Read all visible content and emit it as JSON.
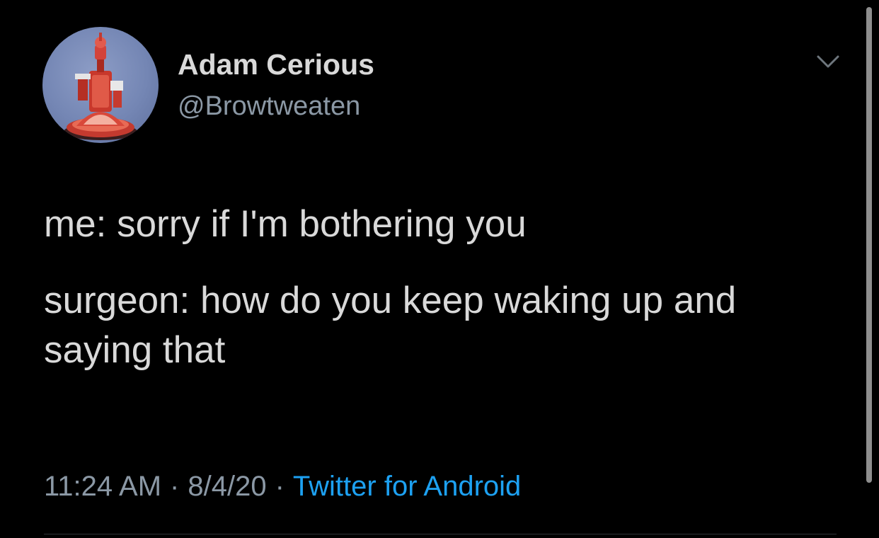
{
  "author": {
    "display_name": "Adam Cerious",
    "handle": "@Browtweaten",
    "avatar_icon": "robot-avatar"
  },
  "tweet": {
    "lines": [
      "me: sorry if I'm bothering you",
      "surgeon: how do you keep waking up and saying that"
    ]
  },
  "meta": {
    "time": "11:24 AM",
    "separator": "·",
    "date": "8/4/20",
    "source": "Twitter for Android"
  },
  "icons": {
    "menu": "chevron-down-icon"
  },
  "colors": {
    "background": "#000000",
    "text": "#d9d9d9",
    "secondary": "#8b98a5",
    "link": "#1da1f2"
  }
}
